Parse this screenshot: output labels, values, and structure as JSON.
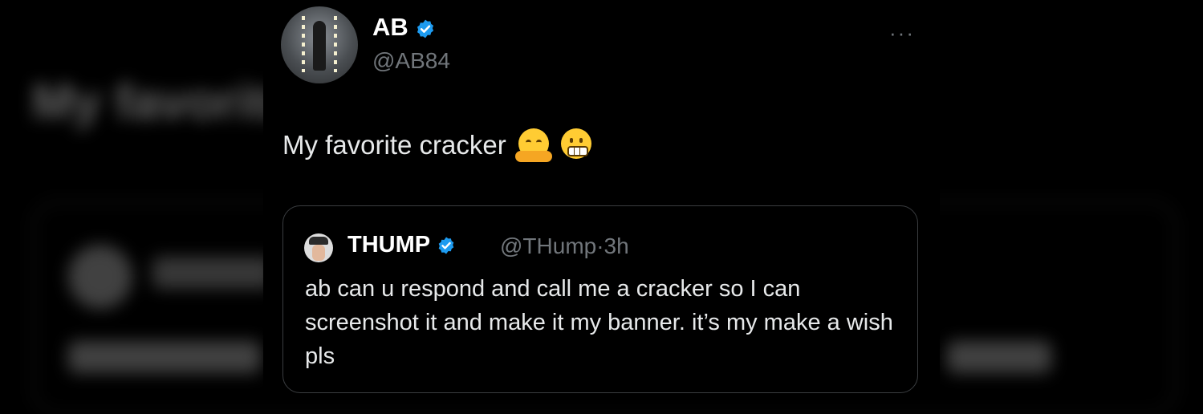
{
  "author": {
    "name": "AB",
    "handle": "@AB84"
  },
  "more_label": "···",
  "tweet": {
    "text": "My favorite cracker",
    "emojis": [
      "hugging-face",
      "grimacing-face"
    ]
  },
  "quote": {
    "name": "THUMP",
    "handle": "@THump",
    "separator": "·",
    "time": "3h",
    "text": "ab can u respond and call me a cracker so I can screenshot it and make it my banner. it’s my make a wish pls"
  },
  "colors": {
    "verified": "#1d9bf0",
    "background": "#000000",
    "secondary_text": "#71767b",
    "border": "#3a3d40"
  }
}
